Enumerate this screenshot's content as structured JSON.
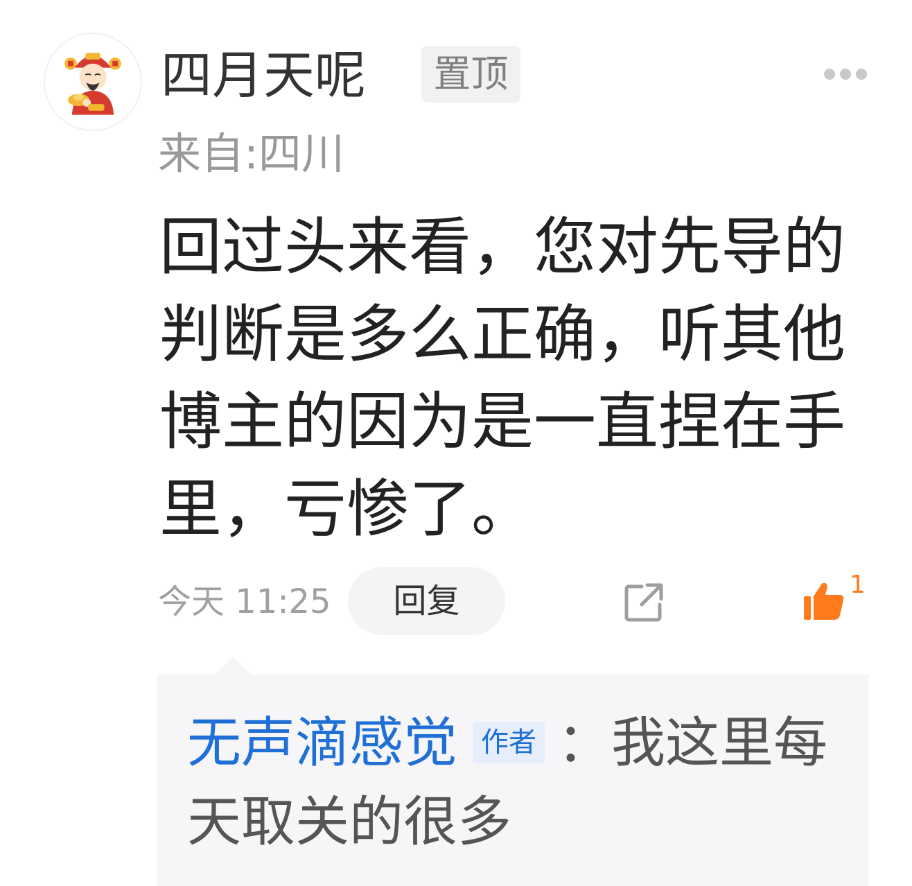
{
  "comment": {
    "username": "四月天呢",
    "pin_label": "置顶",
    "location": "来自:四川",
    "text": "回过头来看，您对先导的判断是多么正确，听其他博主的因为是一直捏在手里，亏惨了。",
    "time": "今天 11:25",
    "reply_label": "回复",
    "like_count": "1"
  },
  "reply": {
    "author": "无声滴感觉",
    "author_badge": "作者",
    "separator": "：",
    "text": "我这里每天取关的很多"
  },
  "icons": {
    "avatar": "caishen-avatar",
    "more": "more-dots-icon",
    "share": "share-icon",
    "like": "thumbs-up-icon"
  },
  "colors": {
    "like_accent": "#ff7a1a",
    "author_link": "#1f6fd6"
  }
}
